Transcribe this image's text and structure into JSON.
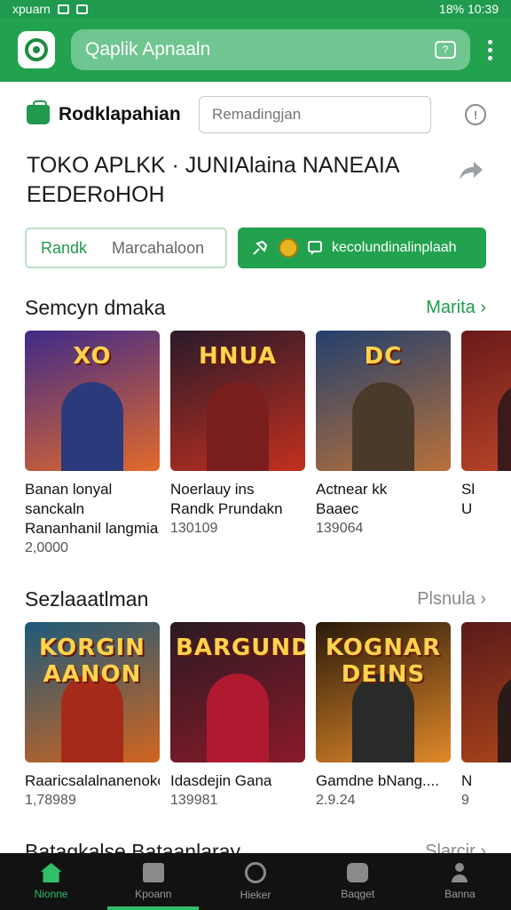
{
  "status_bar": {
    "left": "xpuarn",
    "right": "18% 10:39"
  },
  "app_bar": {
    "search_placeholder": "Qaplik Apnaaln"
  },
  "brand": {
    "name": "Rodklapahian",
    "input_placeholder": "Remadingjan"
  },
  "headline": "TOKO APLKK · JUNIAlaina NANEAIA\nEEDERoHOH",
  "actions": {
    "outline_label": "Randk",
    "outline_sub": "Marcahaloon",
    "solid_label": "kecolundinalinplaah"
  },
  "sections": [
    {
      "title": "Semcyn dmaka",
      "more": "Marita ›",
      "cards": [
        {
          "art": "XO",
          "name": "Banan lonyal sanckaln\nRananhanil langmia",
          "meta": "2,0000",
          "bg1": "#3f2a8a",
          "bg2": "#e36a2a",
          "fig": "#2b3a7a"
        },
        {
          "art": "HNUA",
          "name": "Noerlauy ins\nRandk Prundakn",
          "meta": "130109",
          "bg1": "#2a1a2a",
          "bg2": "#c2301e",
          "fig": "#7a1d1d"
        },
        {
          "art": "DC",
          "name": "Actnear kk\nBaaec",
          "meta": "139064",
          "bg1": "#23406d",
          "bg2": "#b8713a",
          "fig": "#4a3a2a"
        },
        {
          "art": "",
          "name": "Sl\nU",
          "meta": "",
          "bg1": "#6a1a1a",
          "bg2": "#c44a2a",
          "fig": "#3a1a1a"
        }
      ]
    },
    {
      "title": "Sezlaaatlman",
      "more": "Plsnula ›",
      "cards": [
        {
          "art": "KORGIN AANON",
          "name": "Raaricsalalnanenoko",
          "meta": "1,78989",
          "bg1": "#1d5a7a",
          "bg2": "#d2651e",
          "fig": "#a62a1a"
        },
        {
          "art": "BARGUND",
          "name": "Idasdejin Gana",
          "meta": "139981",
          "bg1": "#2a1a22",
          "bg2": "#8a1a2a",
          "fig": "#b01a30"
        },
        {
          "art": "KOGNAR DEINS",
          "name": "Gamdne bNang....",
          "meta": "2.9.24",
          "bg1": "#2a1a0a",
          "bg2": "#e0892a",
          "fig": "#2a2a2a"
        },
        {
          "art": "",
          "name": "N",
          "meta": "9",
          "bg1": "#5a1a1a",
          "bg2": "#b54a1a",
          "fig": "#2a1a1a"
        }
      ]
    },
    {
      "title": "Batagkalse Bataanlaray",
      "more": "Slarcir ›",
      "cards": []
    }
  ],
  "bottom_nav": [
    {
      "label": "Nionne"
    },
    {
      "label": "Kpoann"
    },
    {
      "label": "Hieker"
    },
    {
      "label": "Baqget"
    },
    {
      "label": "Banna"
    }
  ],
  "colors": {
    "accent": "#22a24f",
    "accent_dark": "#1f9a4e",
    "nav_bg": "#121212"
  }
}
